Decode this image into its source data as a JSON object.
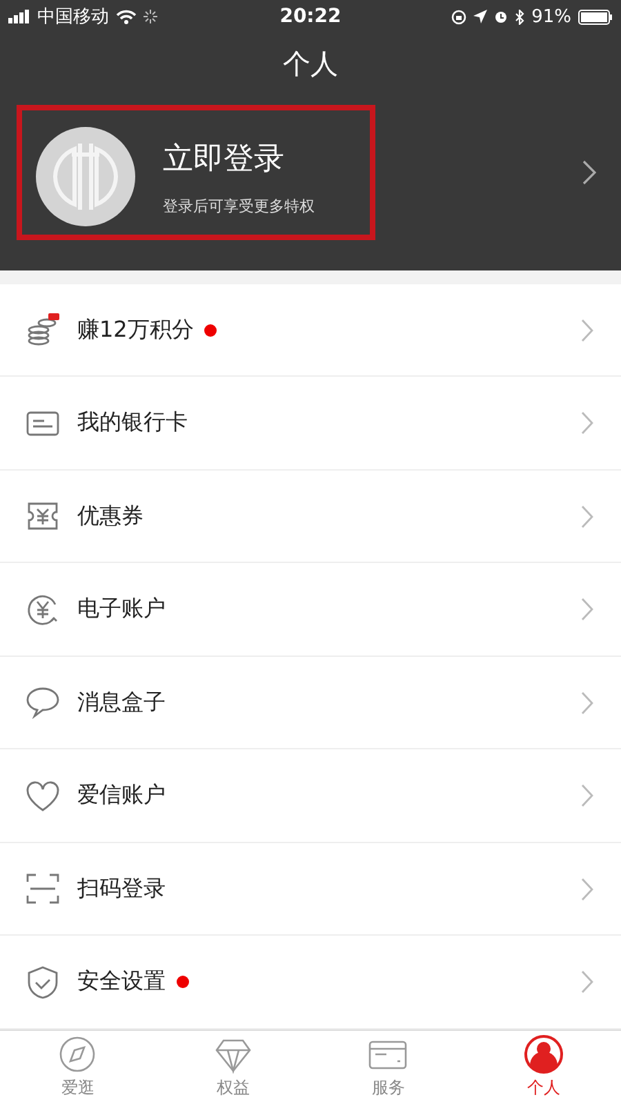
{
  "status_bar": {
    "carrier": "中国移动",
    "time": "20:22",
    "battery": "91%"
  },
  "header": {
    "title": "个人"
  },
  "profile": {
    "name": "立即登录",
    "subtitle": "登录后可享受更多特权",
    "highlighted": true
  },
  "menu": [
    {
      "label": "赚12万积分",
      "dot": true
    },
    {
      "label": "我的银行卡",
      "dot": false
    },
    {
      "label": "优惠券",
      "dot": false
    },
    {
      "label": "电子账户",
      "dot": false
    },
    {
      "label": "消息盒子",
      "dot": false
    },
    {
      "label": "爱信账户",
      "dot": false
    },
    {
      "label": "扫码登录",
      "dot": false
    },
    {
      "label": "安全设置",
      "dot": true
    }
  ],
  "tab_bar": [
    {
      "label": "爱逛",
      "selected": false
    },
    {
      "label": "权益",
      "selected": false
    },
    {
      "label": "服务",
      "selected": false
    },
    {
      "label": "个人",
      "selected": true
    }
  ]
}
